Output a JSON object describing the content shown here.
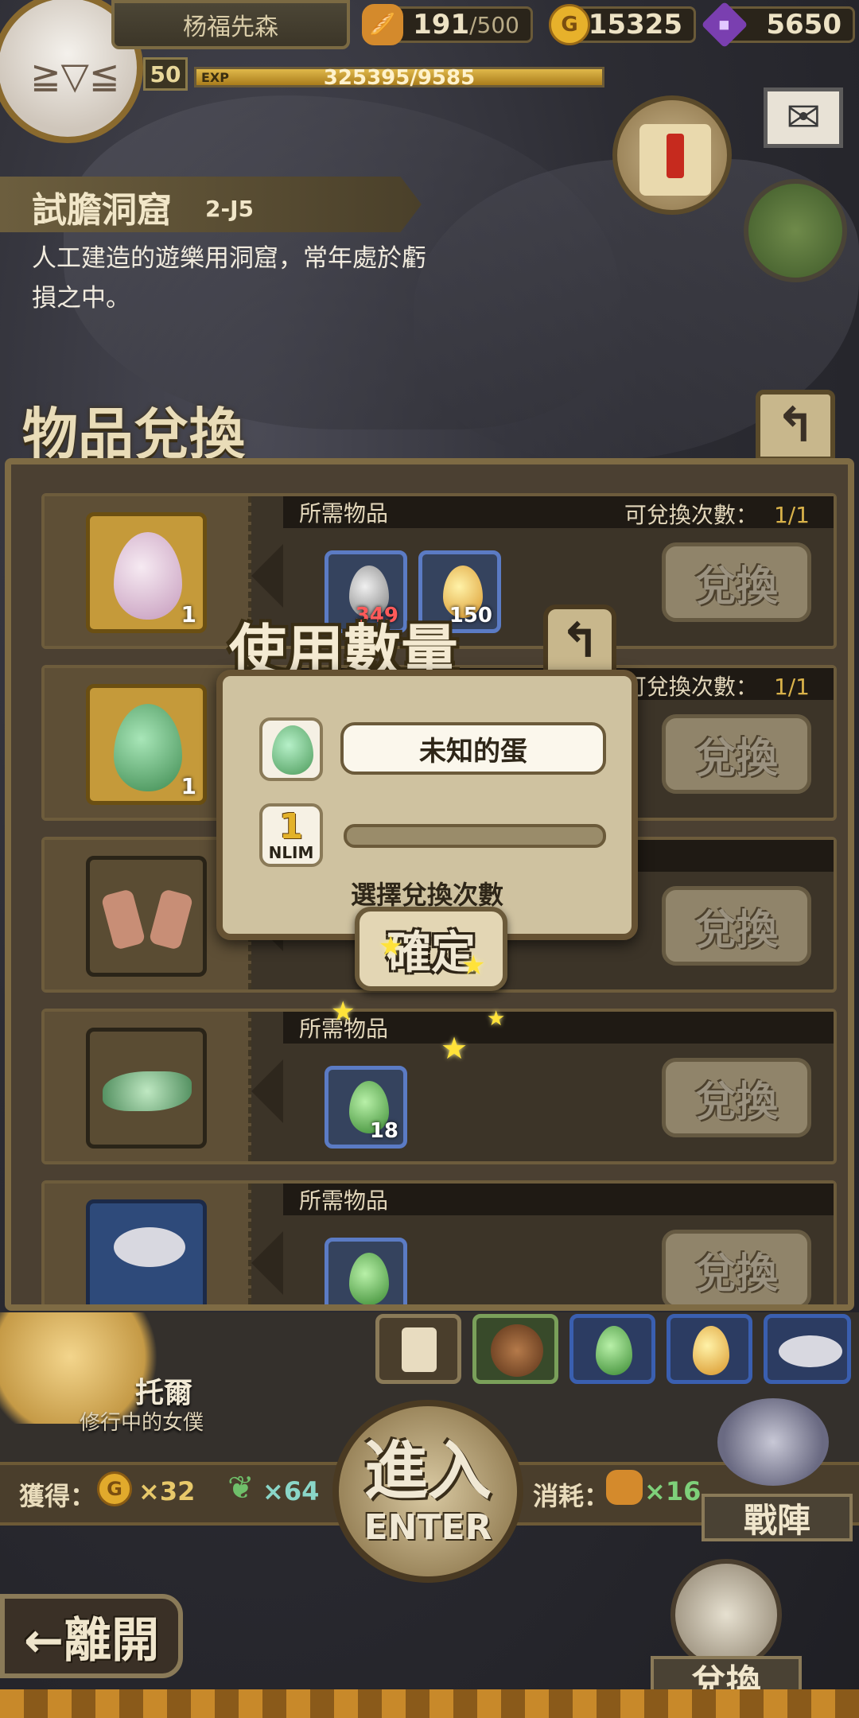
{
  "hud": {
    "player_name": "杨福先森",
    "level": "50",
    "exp_label": "EXP",
    "exp_text": "325395/9585",
    "exp_fill_fraction": 1.0,
    "bread_value": "191",
    "bread_max": "/500",
    "gold_symbol": "G",
    "gold_value": "15325",
    "gem_value": "5650"
  },
  "location": {
    "name": "試膽洞窟",
    "code": "2-J5",
    "description": "人工建造的遊樂用洞窟，常年處於虧損之中。"
  },
  "panel": {
    "title": "物品兌換",
    "back_glyph": "↰",
    "required_label": "所需物品",
    "remaining_label": "可兌換次數：",
    "exchange_label": "兌換",
    "rows": [
      {
        "item_qty": "1",
        "count": "1/1",
        "reqs": [
          {
            "n": "349"
          },
          {
            "n": "150"
          }
        ]
      },
      {
        "item_qty": "1",
        "count": "1/1",
        "reqs": []
      },
      {
        "item_qty": "",
        "count": "",
        "reqs": []
      },
      {
        "item_qty": "",
        "count": "",
        "reqs": [
          {
            "n": "18"
          }
        ]
      },
      {
        "item_qty": "",
        "count": "",
        "reqs": [
          {
            "n": ""
          }
        ]
      }
    ]
  },
  "modal": {
    "title": "使用數量",
    "back_glyph": "↰",
    "item_name": "未知的蛋",
    "quantity": "1",
    "quantity_label": "NLIM",
    "slider_fraction": 0.0,
    "hint": "選擇兌換次數",
    "confirm_label": "確定"
  },
  "bottom": {
    "character_name": "托爾",
    "character_title": "修行中的女僕",
    "gain_label": "獲得：",
    "gain_gold": "×32",
    "gain_leaf": "×64",
    "cost_label": "消耗：",
    "cost_value": "×16",
    "enter_cn": "進入",
    "enter_en": "ENTER",
    "formation_label": "戰陣",
    "leave_label": "←離開",
    "exchange_label": "兌換"
  }
}
